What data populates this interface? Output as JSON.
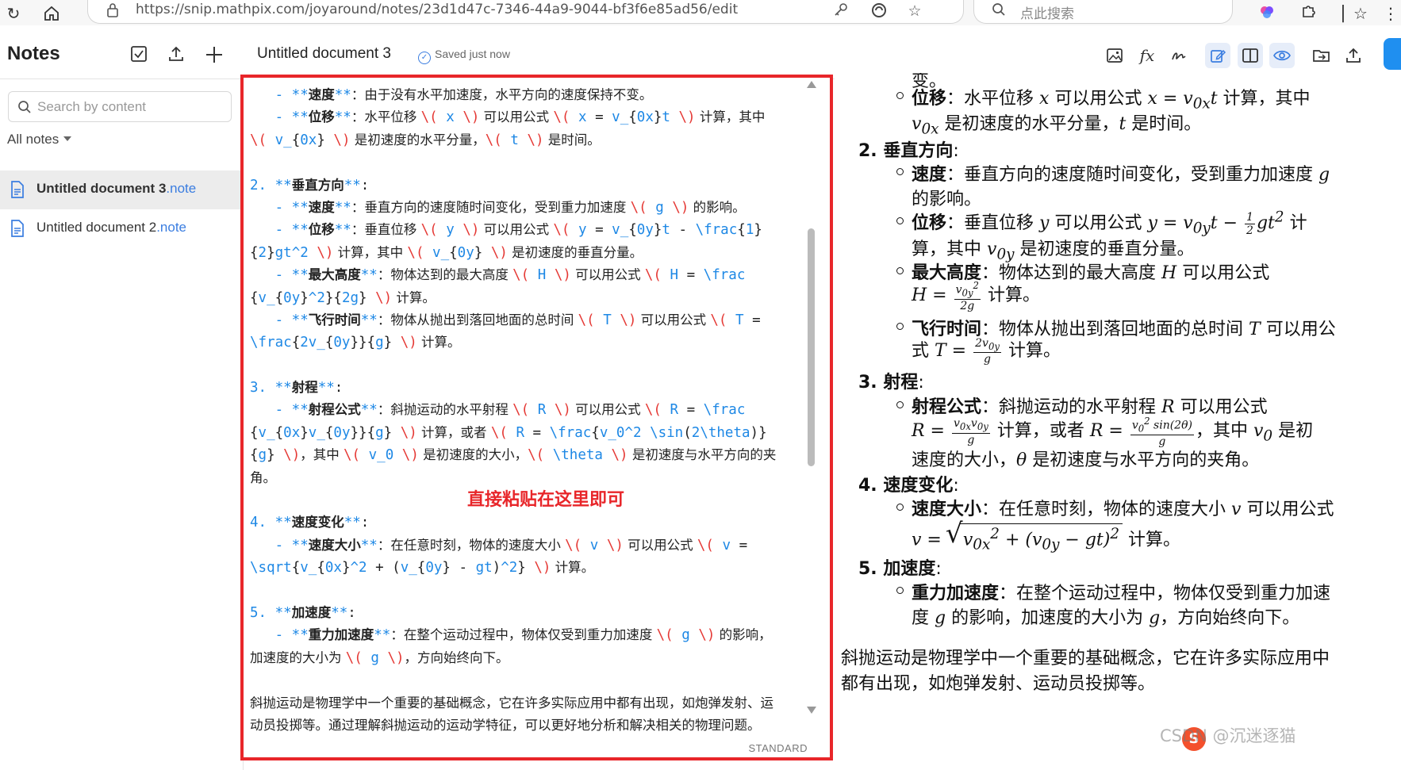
{
  "browser": {
    "url": "https://snip.mathpix.com/joyaround/notes/23d1d47c-7346-44a9-9044-bf3f6e85ad56/edit",
    "search_placeholder": "点此搜索"
  },
  "header": {
    "app_title": "Notes",
    "doc_title": "Untitled document 3",
    "save_status": "Saved just now"
  },
  "sidebar": {
    "search_placeholder": "Search by content",
    "filter_label": "All notes",
    "notes": [
      {
        "name": "Untitled document 3",
        "ext": ".note",
        "active": true
      },
      {
        "name": "Untitled document 2",
        "ext": ".note",
        "active": false
      }
    ]
  },
  "editor": {
    "paste_hint": "直接粘贴在这里即可",
    "mode_label": "STANDARD"
  },
  "preview": {
    "top_fragment": "变。",
    "sec2_title": "垂直方向",
    "sec3_title": "射程",
    "sec4_title": "速度变化",
    "sec5_title": "加速度",
    "footer_line1": "斜抛运动是物理学中一个重要的基础概念，它在许多实际应用中",
    "footer_line2": "都有出现，如炮弹发射、运动员投掷等。"
  },
  "watermark": "CSDN @沉迷逐猫",
  "colors": {
    "accent": "#3a7de0",
    "highlight_border": "#e8262a",
    "markdown_blue": "#1e88e5",
    "share_button": "#1f8ff0"
  }
}
